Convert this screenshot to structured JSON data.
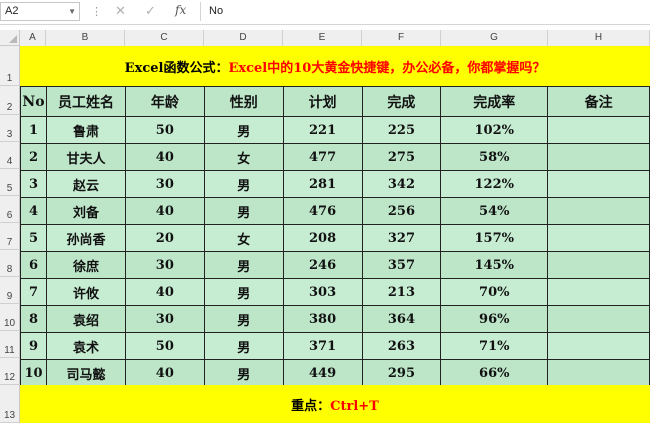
{
  "formula_bar": {
    "name_box": "A2",
    "fx_label": "fx",
    "formula": "No"
  },
  "columns": [
    "A",
    "B",
    "C",
    "D",
    "E",
    "F",
    "G",
    "H"
  ],
  "rows": [
    "1",
    "2",
    "3",
    "4",
    "5",
    "6",
    "7",
    "8",
    "9",
    "10",
    "11",
    "12",
    "13"
  ],
  "title": {
    "prefix": "Excel函数公式：",
    "highlight": "Excel中的10大黄金快捷键，办公必备，你都掌握吗？"
  },
  "table": {
    "headers": [
      "No",
      "员工姓名",
      "年龄",
      "性别",
      "计划",
      "完成",
      "完成率",
      "备注"
    ],
    "rows": [
      [
        "1",
        "鲁肃",
        "50",
        "男",
        "221",
        "225",
        "102%",
        ""
      ],
      [
        "2",
        "甘夫人",
        "40",
        "女",
        "477",
        "275",
        "58%",
        ""
      ],
      [
        "3",
        "赵云",
        "30",
        "男",
        "281",
        "342",
        "122%",
        ""
      ],
      [
        "4",
        "刘备",
        "40",
        "男",
        "476",
        "256",
        "54%",
        ""
      ],
      [
        "5",
        "孙尚香",
        "20",
        "女",
        "208",
        "327",
        "157%",
        ""
      ],
      [
        "6",
        "徐庶",
        "30",
        "男",
        "246",
        "357",
        "145%",
        ""
      ],
      [
        "7",
        "许攸",
        "40",
        "男",
        "303",
        "213",
        "70%",
        ""
      ],
      [
        "8",
        "袁绍",
        "30",
        "男",
        "380",
        "364",
        "96%",
        ""
      ],
      [
        "9",
        "袁术",
        "50",
        "男",
        "371",
        "263",
        "71%",
        ""
      ],
      [
        "10",
        "司马懿",
        "40",
        "男",
        "449",
        "295",
        "66%",
        ""
      ]
    ]
  },
  "footer": {
    "label": "重点：",
    "value": "Ctrl+T"
  },
  "colors": {
    "title_fill": "#ffff00",
    "table_fill": "#bfe9cc",
    "highlight_text": "#ff0000"
  }
}
